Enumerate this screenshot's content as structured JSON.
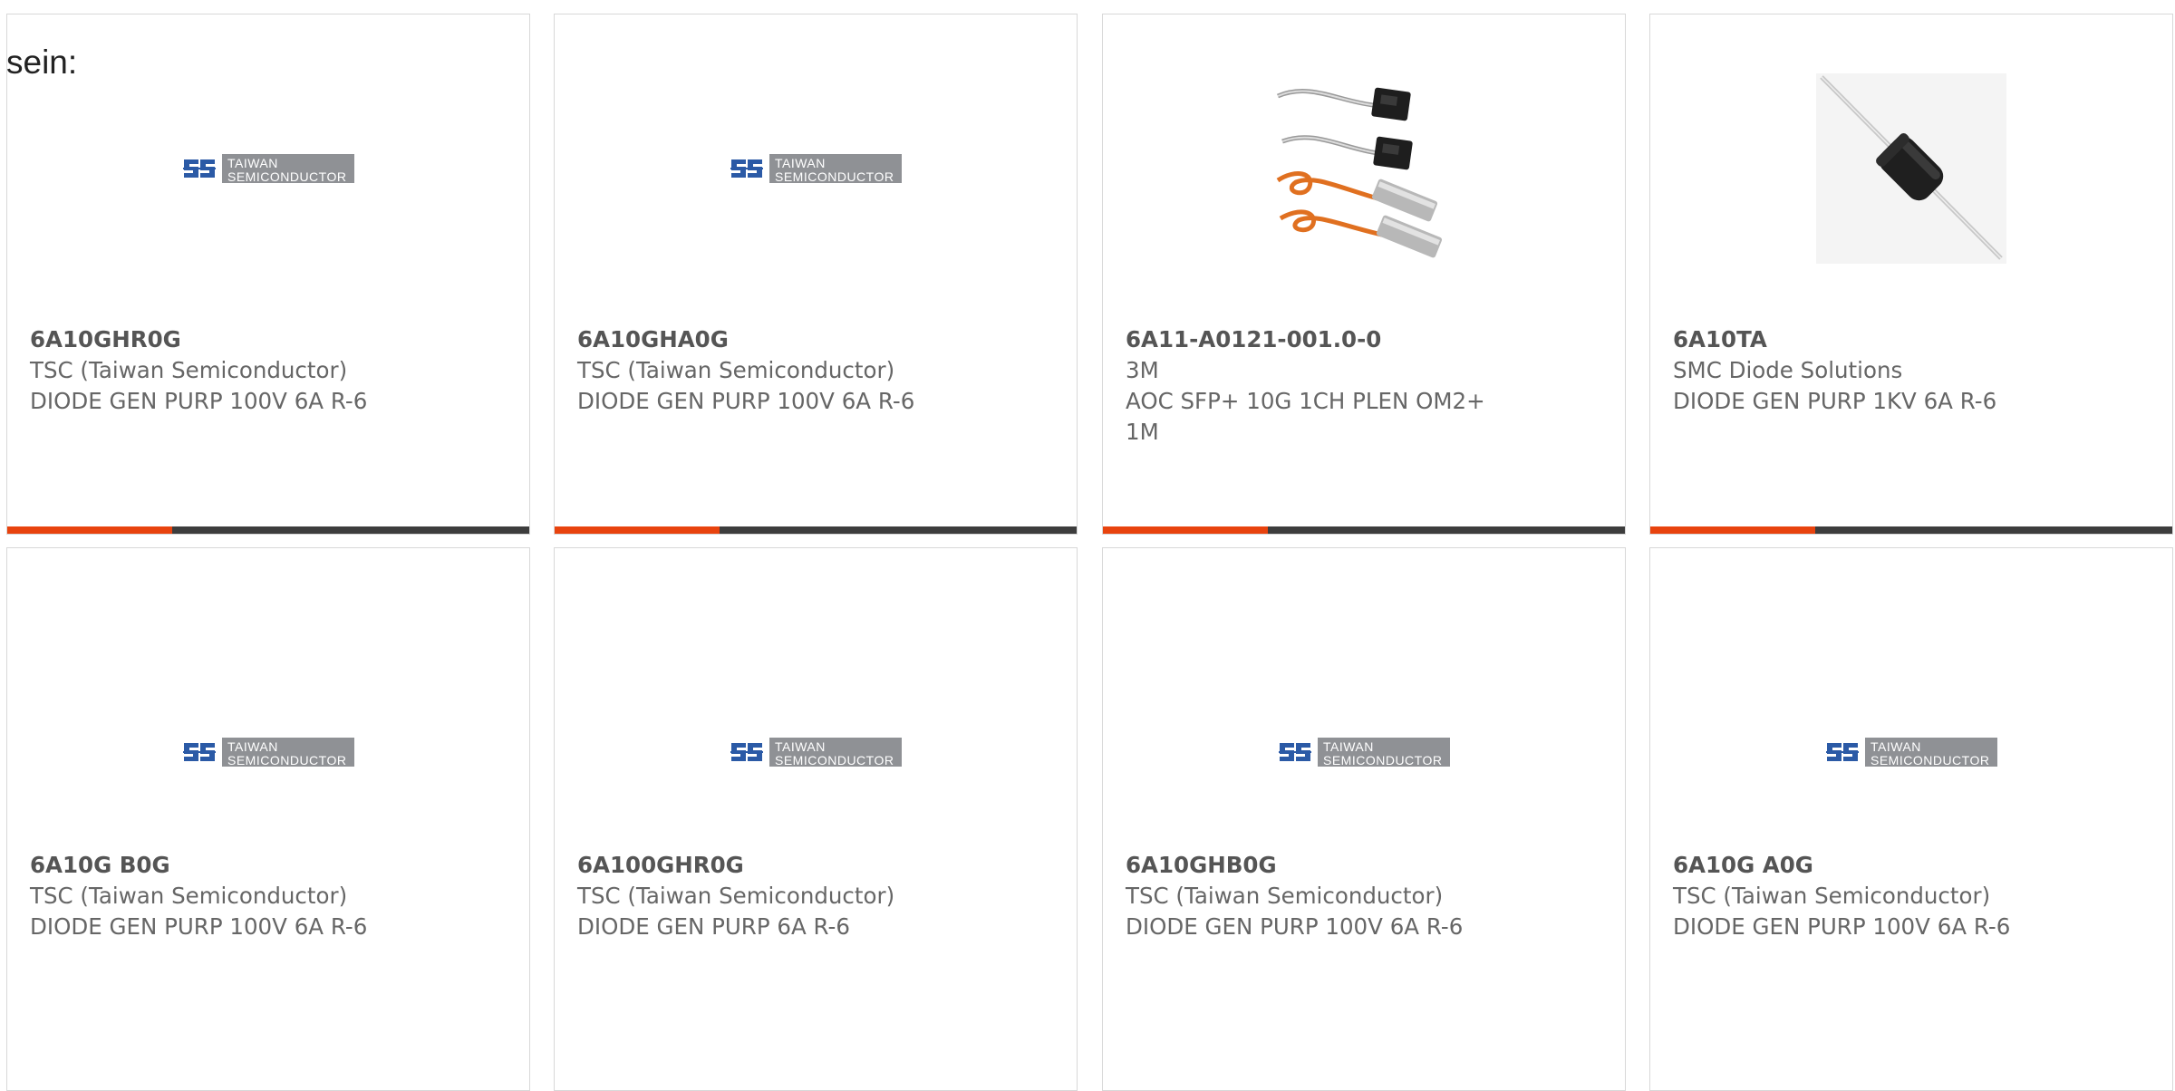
{
  "intro_text": "sein:",
  "colors": {
    "accent": "#e8430e",
    "bar": "#3d3d3d",
    "tsc_blue": "#2b5aa6",
    "tsc_plate": "#8f9195"
  },
  "logo": {
    "line1": "TAIWAN",
    "line2": "SEMICONDUCTOR"
  },
  "products": [
    {
      "part": "6A10GHR0G",
      "maker": "TSC (Taiwan Semiconductor)",
      "desc": "DIODE GEN PURP 100V 6A R-6",
      "image": "tsc-logo"
    },
    {
      "part": "6A10GHA0G",
      "maker": "TSC (Taiwan Semiconductor)",
      "desc": "DIODE GEN PURP 100V 6A R-6",
      "image": "tsc-logo"
    },
    {
      "part": "6A11-A0121-001.0-0",
      "maker": "3M",
      "desc": "AOC SFP+ 10G 1CH PLEN OM2+ 1M",
      "image": "cable-photo"
    },
    {
      "part": "6A10TA",
      "maker": "SMC Diode Solutions",
      "desc": "DIODE GEN PURP 1KV 6A R-6",
      "image": "diode-photo"
    },
    {
      "part": "6A10G B0G",
      "maker": "TSC (Taiwan Semiconductor)",
      "desc": "DIODE GEN PURP 100V 6A R-6",
      "image": "tsc-logo"
    },
    {
      "part": "6A100GHR0G",
      "maker": "TSC (Taiwan Semiconductor)",
      "desc": "DIODE GEN PURP 6A R-6",
      "image": "tsc-logo"
    },
    {
      "part": "6A10GHB0G",
      "maker": "TSC (Taiwan Semiconductor)",
      "desc": "DIODE GEN PURP 100V 6A R-6",
      "image": "tsc-logo"
    },
    {
      "part": "6A10G A0G",
      "maker": "TSC (Taiwan Semiconductor)",
      "desc": "DIODE GEN PURP 100V 6A R-6",
      "image": "tsc-logo"
    }
  ]
}
